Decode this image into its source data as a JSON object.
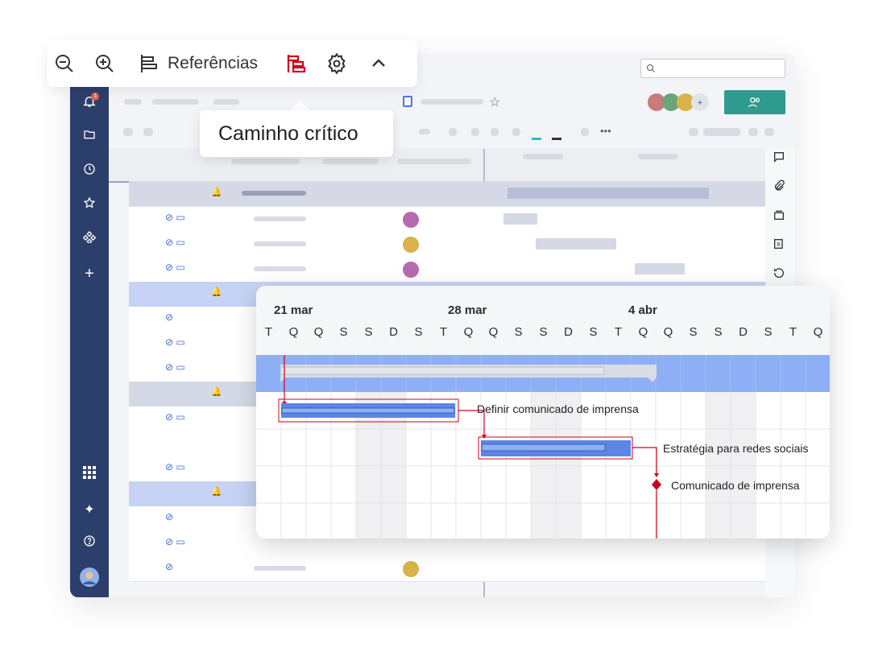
{
  "toolbar": {
    "zoom_out_icon": "zoom-out-icon",
    "zoom_in_icon": "zoom-in-icon",
    "references_label": "Referências",
    "critical_path_icon": "critical-path-icon",
    "settings_icon": "gear-icon",
    "collapse_icon": "chevron-up-icon"
  },
  "tooltip": {
    "text": "Caminho crítico"
  },
  "gantt": {
    "months": [
      "21 mar",
      "28 mar",
      "4 abr"
    ],
    "days": [
      "T",
      "Q",
      "Q",
      "S",
      "S",
      "D",
      "S",
      "T",
      "Q",
      "Q",
      "S",
      "S",
      "D",
      "S",
      "T",
      "Q",
      "Q",
      "S",
      "S",
      "D",
      "S",
      "T",
      "Q"
    ],
    "tasks": [
      {
        "label": "Definir comunicado de imprensa"
      },
      {
        "label": "Estratégia para redes sociais"
      },
      {
        "label": "Comunicado de imprensa"
      }
    ]
  },
  "sidebar": {
    "notification_count": "3",
    "icons": [
      "bell-icon",
      "folder-icon",
      "clock-icon",
      "star-icon",
      "integrations-icon",
      "plus-icon",
      "apps-grid-icon",
      "sparkle-icon",
      "help-icon",
      "user-avatar"
    ]
  },
  "colors": {
    "sidebar": "#2c3e6b",
    "critical_path": "#d0021b",
    "gantt_bar": "#5b86e5",
    "summary_row": "#8eaef5",
    "share_button": "#2f9a8e"
  }
}
